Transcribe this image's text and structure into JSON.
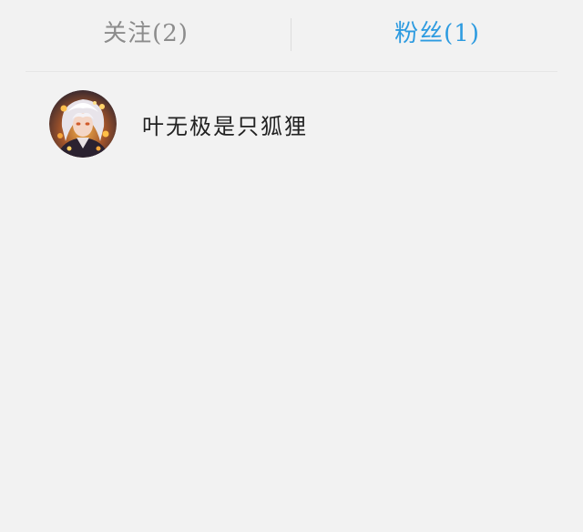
{
  "tabs": [
    {
      "label": "关注(2)",
      "active": false
    },
    {
      "label": "粉丝(1)",
      "active": true
    }
  ],
  "followers": [
    {
      "name": "叶无极是只狐狸",
      "avatar_icon": "anime-avatar-icon"
    }
  ],
  "colors": {
    "background": "#f2f2f2",
    "active_tab": "#2d9be0",
    "inactive_tab": "#8c8c8c"
  }
}
